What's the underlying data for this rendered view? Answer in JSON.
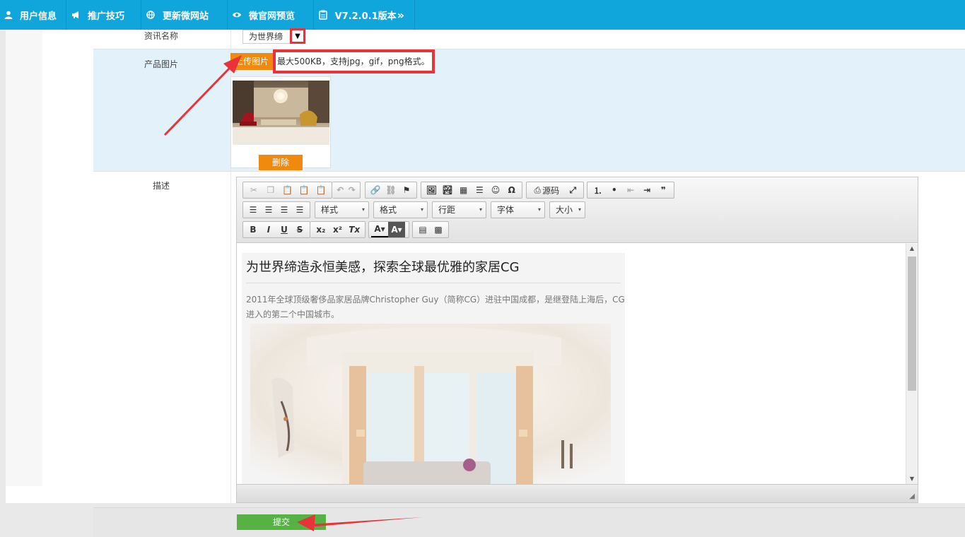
{
  "nav": {
    "items": [
      {
        "label": "用户信息",
        "icon": "user-icon"
      },
      {
        "label": "推广技巧",
        "icon": "megaphone-icon"
      },
      {
        "label": "更新微网站",
        "icon": "globe-icon"
      },
      {
        "label": "微官网预览",
        "icon": "eye-icon"
      },
      {
        "label": "V7.2.0.1版本",
        "icon": "clipboard-icon",
        "suffix": "»"
      }
    ]
  },
  "form": {
    "name_label": "资讯名称",
    "name_value": "为世界缔",
    "image_label": "产品图片",
    "upload_button": "上传图片",
    "upload_hint": "最大500KB，支持jpg，gif，png格式。",
    "delete_button": "删除",
    "desc_label": "描述",
    "submit_button": "提交"
  },
  "editor": {
    "source_label": "源码",
    "combos": {
      "style": "样式",
      "format": "格式",
      "line_height": "行距",
      "font": "字体",
      "size": "大小"
    },
    "article": {
      "title": "为世界缔造永恒美感，探索全球最优雅的家居CG",
      "body": "2011年全球顶级奢侈品家居品牌Christopher Guy（简称CG）进驻中国成都，是继登陆上海后，CG进入的第二个中国城市。"
    }
  },
  "colors": {
    "nav_bg": "#10a6dc",
    "orange": "#f08a0e",
    "green": "#55b243",
    "highlight_red": "#e8333a",
    "image_row_bg": "#e3f1fb"
  }
}
